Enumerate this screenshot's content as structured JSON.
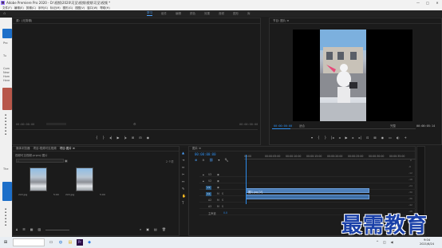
{
  "window": {
    "app_icon": "Pr",
    "title": "Adobe Premiere Pro 2020 - D:\\视频\\2020\\可见\\视频\\视频\\可见\\视频 *",
    "controls": [
      "—",
      "□",
      "✕"
    ]
  },
  "menu": [
    "文件(F)",
    "编辑(E)",
    "剪辑(C)",
    "序列(S)",
    "标记(M)",
    "图形(G)",
    "视图(V)",
    "窗口(W)",
    "帮助(H)"
  ],
  "workspaces": {
    "tabs": [
      "学习",
      "组件",
      "编辑",
      "颜色",
      "效果",
      "音频",
      "图形",
      "库"
    ],
    "active_index": 0
  },
  "left_strip": {
    "labels": [
      "Pro",
      "Tu",
      "Com",
      "New",
      "Hom",
      "Here",
      "The"
    ]
  },
  "source_panel": {
    "title": "源：(无剪辑)",
    "timecode_left": "00:00:00:00",
    "timecode_right": "00:00:00:00"
  },
  "program_panel": {
    "title": "节目: 图片 ≡",
    "timecode": "00:00:00:00",
    "fit": "适合",
    "quality": "完整",
    "duration": "00:00:05:14",
    "scrub_progress": 0.13
  },
  "project_panel": {
    "tabs": [
      "媒体浏览器",
      "项目:视频可见视频",
      "项目:图片 ≡"
    ],
    "header": "项目:图片项目 ≡",
    "path": "视频可见视频.prproj 图片",
    "item_count": "2 个项",
    "search_placeholder": "",
    "items": [
      {
        "name": "222.jpg",
        "duration": "5:00"
      },
      {
        "name": "222.jpg",
        "duration": "5:00"
      }
    ]
  },
  "timeline": {
    "title": "图片 ≡",
    "timecode": "00:00:00:00",
    "ruler_labels": [
      "00:00",
      "00:00:05:00",
      "00:00:10:00",
      "00:00:15:00",
      "00:00:20:00",
      "00:00:25:00",
      "00:00:30:00",
      "00:00:35:00"
    ],
    "tracks": [
      {
        "name": "V3",
        "selected": false
      },
      {
        "name": "V2",
        "selected": false
      },
      {
        "name": "V1",
        "selected": true
      },
      {
        "name": "A1",
        "selected": true
      },
      {
        "name": "A2",
        "selected": false
      },
      {
        "name": "A3",
        "selected": false
      }
    ],
    "master": "主声道",
    "master_value": "0.0",
    "clips": [
      {
        "label": "图片.jpg [V]",
        "track": "V1"
      },
      {
        "label": "",
        "track": "A1"
      }
    ]
  },
  "meter": {
    "labels": [
      "0",
      "-6",
      "-12",
      "-18",
      "-24",
      "-30",
      "-36",
      "-42",
      "-48",
      "-54"
    ],
    "db_unit": "dB"
  },
  "taskbar": {
    "clock_time": "9:04",
    "clock_date": "2021/6/24"
  },
  "watermark": {
    "text": "最需教育"
  }
}
